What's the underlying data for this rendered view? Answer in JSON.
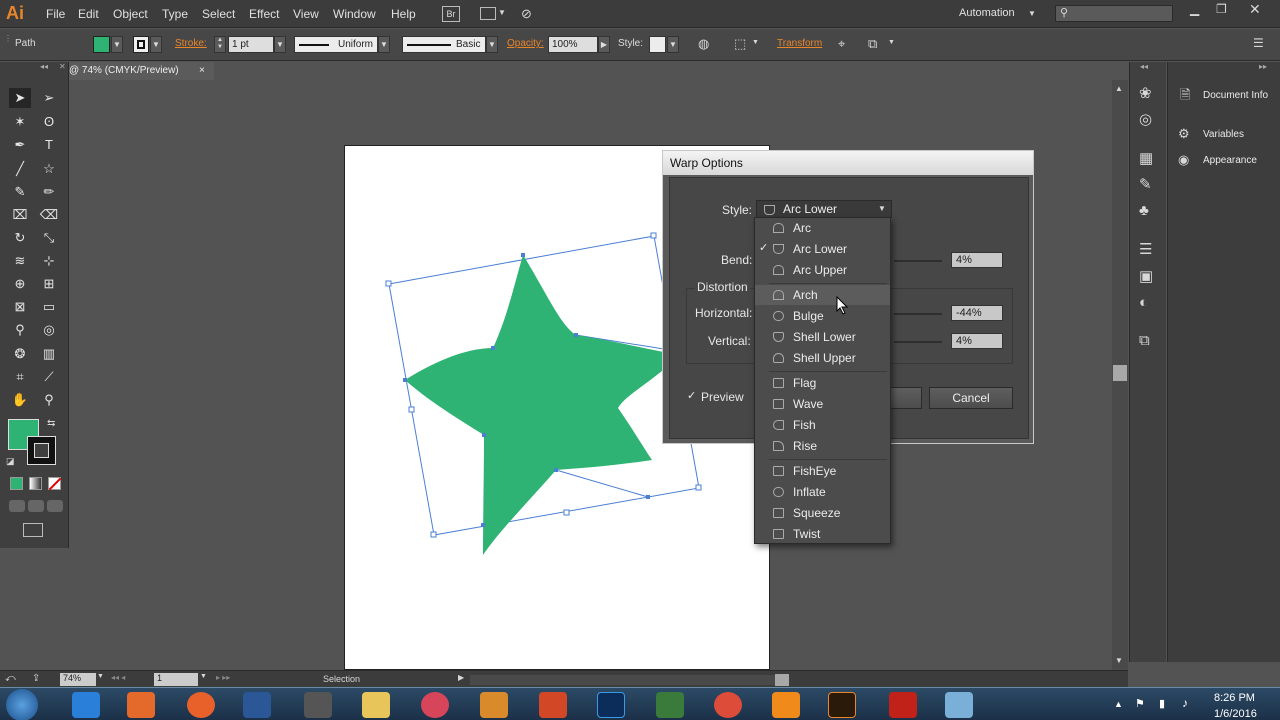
{
  "app": {
    "logo": "Ai",
    "menu": [
      "File",
      "Edit",
      "Object",
      "Type",
      "Select",
      "Effect",
      "View",
      "Window",
      "Help"
    ],
    "br_label": "Br",
    "workspace": "Automation"
  },
  "control_bar": {
    "selection_type": "Path",
    "stroke_label": "Stroke:",
    "stroke_value": "1 pt",
    "profile": "Uniform",
    "brush": "Basic",
    "opacity_label": "Opacity:",
    "opacity_value": "100%",
    "style_label": "Style:",
    "transform_label": "Transform"
  },
  "document": {
    "tab_title": "@ 74% (CMYK/Preview)",
    "close": "×"
  },
  "status": {
    "zoom": "74%",
    "artboard": "1",
    "tool": "Selection"
  },
  "right_panel": {
    "items": [
      "Document Info",
      "Variables",
      "Appearance"
    ]
  },
  "dialog": {
    "title": "Warp Options",
    "style_label": "Style:",
    "style_value": "Arc Lower",
    "bend_label": "Bend:",
    "bend_value": "4%",
    "distortion_label": "Distortion",
    "horizontal_label": "Horizontal:",
    "horizontal_value": "-44%",
    "vertical_label": "Vertical:",
    "vertical_value": "4%",
    "preview_label": "Preview",
    "cancel_label": "Cancel"
  },
  "dropdown": {
    "groups": [
      [
        "Arc",
        "Arc Lower",
        "Arc Upper"
      ],
      [
        "Arch",
        "Bulge",
        "Shell Lower",
        "Shell Upper"
      ],
      [
        "Flag",
        "Wave",
        "Fish",
        "Rise"
      ],
      [
        "FishEye",
        "Inflate",
        "Squeeze",
        "Twist"
      ]
    ],
    "selected": "Arc Lower",
    "hovered": "Arch"
  },
  "colors": {
    "fill": "#2eb374",
    "accent": "#e9862a",
    "bounding_box": "#4a7fd4"
  },
  "taskbar": {
    "time": "8:26 PM",
    "date": "1/6/2016"
  }
}
